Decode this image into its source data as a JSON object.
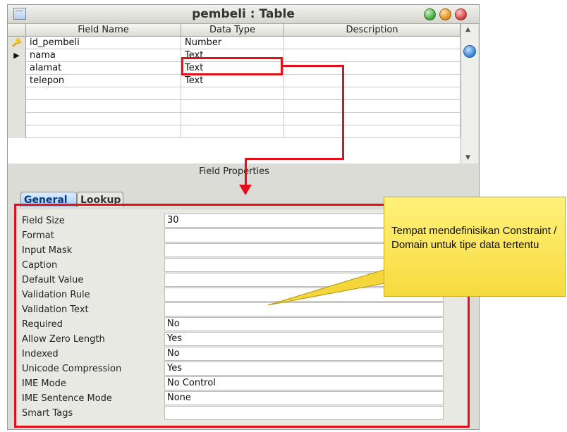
{
  "window": {
    "title": "pembeli : Table"
  },
  "design_grid": {
    "columns": [
      "Field Name",
      "Data Type",
      "Description"
    ],
    "rows": [
      {
        "field_name": "id_pembeli",
        "data_type": "Number",
        "description": "",
        "indicator": "key-icon"
      },
      {
        "field_name": "nama",
        "data_type": "Text",
        "description": "",
        "indicator": "row-pointer-icon"
      },
      {
        "field_name": "alamat",
        "data_type": "Text",
        "description": "",
        "indicator": ""
      },
      {
        "field_name": "telepon",
        "data_type": "Text",
        "description": "",
        "indicator": ""
      },
      {
        "field_name": "",
        "data_type": "",
        "description": "",
        "indicator": ""
      },
      {
        "field_name": "",
        "data_type": "",
        "description": "",
        "indicator": ""
      },
      {
        "field_name": "",
        "data_type": "",
        "description": "",
        "indicator": ""
      },
      {
        "field_name": "",
        "data_type": "",
        "description": "",
        "indicator": ""
      }
    ]
  },
  "field_properties": {
    "label": "Field Properties",
    "tabs": [
      "General",
      "Lookup"
    ],
    "active_tab": "General",
    "rows": [
      {
        "label": "Field Size",
        "value": "30"
      },
      {
        "label": "Format",
        "value": ""
      },
      {
        "label": "Input Mask",
        "value": ""
      },
      {
        "label": "Caption",
        "value": ""
      },
      {
        "label": "Default Value",
        "value": ""
      },
      {
        "label": "Validation Rule",
        "value": ""
      },
      {
        "label": "Validation Text",
        "value": ""
      },
      {
        "label": "Required",
        "value": "No"
      },
      {
        "label": "Allow Zero Length",
        "value": "Yes"
      },
      {
        "label": "Indexed",
        "value": "No"
      },
      {
        "label": "Unicode Compression",
        "value": "Yes"
      },
      {
        "label": "IME Mode",
        "value": "No Control"
      },
      {
        "label": "IME Sentence Mode",
        "value": "None"
      },
      {
        "label": "Smart Tags",
        "value": ""
      }
    ]
  },
  "callout": {
    "text": "Tempat mendefinisikan Constraint / Domain untuk tipe data tertentu"
  },
  "colors": {
    "highlight_red": "#e3101a",
    "callout_yellow": "#f7da3e"
  }
}
